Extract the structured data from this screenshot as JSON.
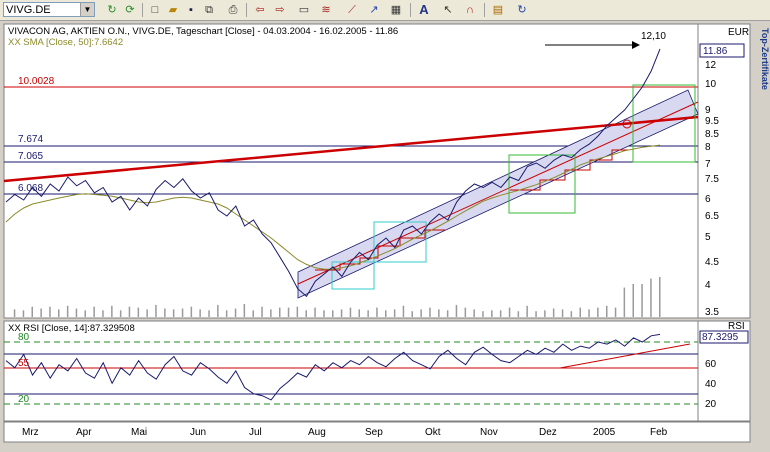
{
  "toolbar": {
    "symbol_value": "VIVG.DE",
    "icons": [
      "refresh-icon",
      "new-icon",
      "open-icon",
      "save-icon",
      "copy-icon",
      "print-icon",
      "back-icon",
      "forward-icon",
      "chart-type-icon",
      "indicator-icon",
      "drawing-icon",
      "trendline-icon",
      "settings-icon",
      "text-icon",
      "cursor-icon",
      "magnet-icon",
      "template-icon",
      "redo-icon"
    ],
    "text_button": "A"
  },
  "side_tab": {
    "label": "Top-Zertifikate"
  },
  "price_panel": {
    "header": "VIVACON AG, AKTIEN O.N., VIVG.DE, Tageschart [Close] - 04.03.2004 - 16.02.2005 - 11.86",
    "sma_label": "XX SMA [Close, 50]:7.6642",
    "currency": "EUR",
    "y_ticks": [
      "12",
      "11",
      "10",
      "9",
      "8",
      "7",
      "6",
      "5",
      "4.5",
      "4",
      "3.5"
    ],
    "extra_ticks": [
      "9.5",
      "8.5",
      "7.5",
      "6.5",
      "5.5"
    ],
    "last_price_box": "11.86",
    "annotation_peak": "12,10",
    "level_labels": [
      "10.0028",
      "7.674",
      "7.065",
      "6.068"
    ]
  },
  "rsi_panel": {
    "header": "XX RSI [Close, 14]:87.329508",
    "tag": "RSI",
    "value_box": "87.3295",
    "y_ticks": [
      "80",
      "60",
      "40",
      "20"
    ],
    "level_labels": [
      "80",
      "55",
      "20"
    ]
  },
  "x_axis": {
    "labels": [
      "Mrz",
      "Apr",
      "Mai",
      "Jun",
      "Jul",
      "Aug",
      "Sep",
      "Okt",
      "Nov",
      "Dez",
      "2005",
      "Feb"
    ]
  },
  "colors": {
    "price_line": "#1a1a6e",
    "sma": "#8b8b2a",
    "resistance": "#cc0000",
    "channel_fill": "#d8d8f0",
    "green_box": "#33bb33",
    "cyan_box": "#33cccc"
  },
  "chart_data": {
    "type": "line",
    "series": [
      {
        "values": [
          5.9,
          6.1,
          5.95,
          6.3,
          6.05,
          6.4,
          6.2,
          6.6,
          6.35,
          6.5,
          6.15,
          6.3,
          5.9,
          6.05,
          5.7,
          6.0,
          5.8,
          6.25,
          6.5,
          6.3,
          6.55,
          6.2,
          6.0,
          6.15,
          5.7,
          5.55,
          5.8,
          5.3,
          5.45,
          5.1,
          4.9,
          4.6,
          4.3,
          3.95,
          3.8,
          4.1,
          4.25,
          4.4,
          4.2,
          4.5,
          4.7,
          4.55,
          4.85,
          5.0,
          4.8,
          5.2,
          5.3,
          5.1,
          5.4,
          5.6,
          5.45,
          5.9,
          6.2,
          6.4,
          6.3,
          6.45,
          6.3,
          6.6,
          6.5,
          6.9,
          7.0,
          6.85,
          7.1,
          7.3,
          7.2,
          7.5,
          7.7,
          8.0,
          8.4,
          8.7,
          9.0,
          9.5,
          10.0,
          10.8,
          11.86
        ]
      },
      {
        "name": "XX SMA [Close, 50]",
        "values": [
          5.4,
          5.6,
          5.75,
          5.85,
          5.9,
          5.95,
          6.0,
          6.05,
          6.1,
          6.12,
          6.1,
          6.08,
          6.05,
          6.0,
          5.95,
          5.9,
          5.88,
          5.9,
          5.95,
          6.0,
          6.02,
          6.0,
          5.95,
          5.9,
          5.85,
          5.75,
          5.6,
          5.45,
          5.3,
          5.15,
          5.0,
          4.85,
          4.7,
          4.55,
          4.45,
          4.38,
          4.35,
          4.35,
          4.38,
          4.42,
          4.48,
          4.55,
          4.62,
          4.7,
          4.78,
          4.88,
          4.98,
          5.08,
          5.18,
          5.3,
          5.42,
          5.55,
          5.68,
          5.8,
          5.92,
          6.0,
          6.08,
          6.15,
          6.22,
          6.3,
          6.38,
          6.48,
          6.58,
          6.7,
          6.82,
          6.95,
          7.05,
          7.15,
          7.25,
          7.35,
          7.45,
          7.52,
          7.58,
          7.62,
          7.6642
        ]
      },
      {
        "name": "XX RSI [Close, 14]",
        "values": [
          62,
          55,
          68,
          48,
          60,
          45,
          58,
          52,
          64,
          50,
          45,
          60,
          40,
          55,
          48,
          62,
          50,
          44,
          58,
          66,
          52,
          48,
          60,
          54,
          46,
          40,
          52,
          36,
          30,
          28,
          24,
          35,
          42,
          50,
          46,
          58,
          52,
          60,
          55,
          62,
          58,
          66,
          60,
          56,
          64,
          70,
          62,
          58,
          54,
          66,
          72,
          64,
          58,
          70,
          75,
          68,
          62,
          60,
          66,
          72,
          68,
          74,
          70,
          78,
          72,
          76,
          74,
          80,
          78,
          82,
          76,
          84,
          80,
          86,
          87.33
        ]
      }
    ],
    "ylim": [
      3.5,
      12.5
    ]
  }
}
